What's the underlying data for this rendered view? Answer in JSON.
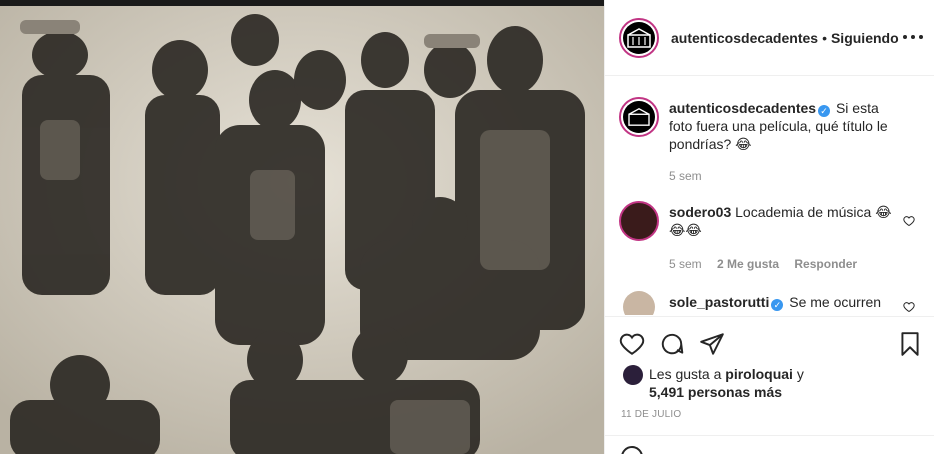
{
  "post": {
    "photo_alt": "Foto de la banda",
    "username": "autenticosdecadentes",
    "separator": "•",
    "follow_status": "Siguiendo"
  },
  "caption": {
    "username": "autenticosdecadentes",
    "text": "Si esta foto fuera una película, qué título le pondrías? 😂",
    "time": "5 sem"
  },
  "comments": [
    {
      "username": "sodero03",
      "text": "Locademia de música 😂😂😂",
      "time": "5 sem",
      "likes": "2 Me gusta",
      "reply": "Responder"
    },
    {
      "username": "sole_pastorutti",
      "text": "Se me ocurren"
    }
  ],
  "likes": {
    "prefix": "Les gusta a",
    "user": "piroloquai",
    "conjunction": "y",
    "count": "5,491 personas más"
  },
  "date": "11 DE JULIO",
  "icons": {
    "more": "more-icon",
    "heart": "heart-icon",
    "comment": "comment-icon",
    "share": "share-icon",
    "save": "bookmark-icon",
    "verified": "verified-icon"
  },
  "colors": {
    "text": "#262626",
    "muted": "#8e8e8e",
    "verified": "#3897f0",
    "ring": "#c13584"
  }
}
